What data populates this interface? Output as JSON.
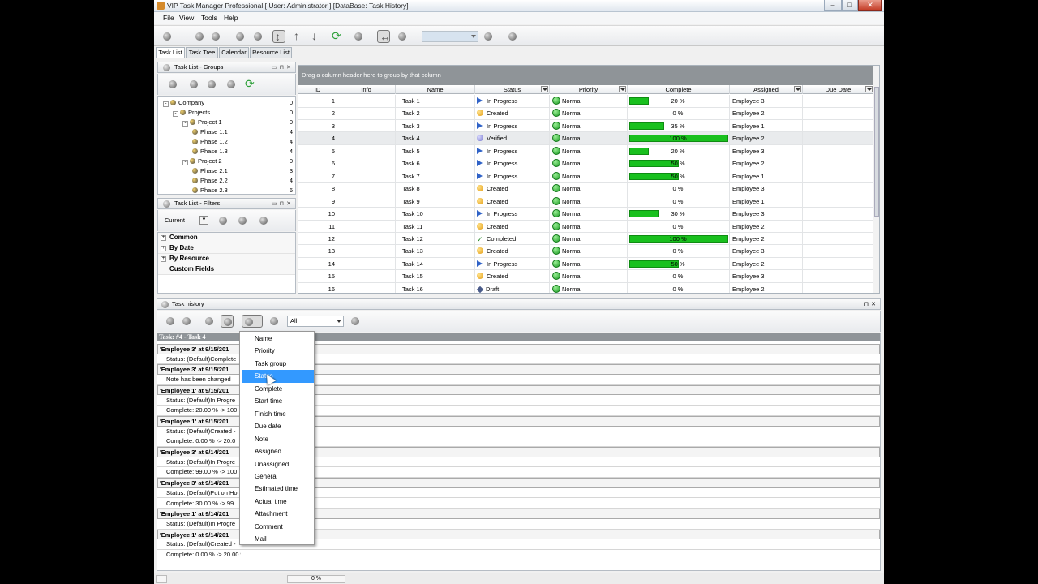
{
  "window": {
    "title": "VIP Task Manager Professional [ User: Administrator ] [DataBase: Task History]",
    "controls": {
      "minimize": "–",
      "maximize": "□",
      "close": "✕"
    }
  },
  "menu": [
    "File",
    "View",
    "Tools",
    "Help"
  ],
  "tabs": [
    "Task List",
    "Task Tree",
    "Calendar",
    "Resource List"
  ],
  "groups_panel": {
    "title": "Task List - Groups",
    "tree": [
      {
        "label": "Company",
        "count": "0",
        "level": 0,
        "toggle": "-"
      },
      {
        "label": "Projects",
        "count": "0",
        "level": 1,
        "toggle": "-"
      },
      {
        "label": "Project 1",
        "count": "0",
        "level": 2,
        "toggle": "-"
      },
      {
        "label": "Phase 1.1",
        "count": "4",
        "level": 3,
        "toggle": ""
      },
      {
        "label": "Phase 1.2",
        "count": "4",
        "level": 3,
        "toggle": ""
      },
      {
        "label": "Phase 1.3",
        "count": "4",
        "level": 3,
        "toggle": ""
      },
      {
        "label": "Project 2",
        "count": "0",
        "level": 2,
        "toggle": "-"
      },
      {
        "label": "Phase 2.1",
        "count": "3",
        "level": 3,
        "toggle": ""
      },
      {
        "label": "Phase 2.2",
        "count": "4",
        "level": 3,
        "toggle": ""
      },
      {
        "label": "Phase 2.3",
        "count": "6",
        "level": 3,
        "toggle": ""
      }
    ]
  },
  "filters_panel": {
    "title": "Task List - Filters",
    "current": "Current",
    "items": [
      {
        "label": "Common",
        "expandable": true
      },
      {
        "label": "By Date",
        "expandable": true
      },
      {
        "label": "By Resource",
        "expandable": true
      },
      {
        "label": "Custom Fields",
        "expandable": false
      }
    ]
  },
  "grid": {
    "group_hint": "Drag a column header here to group by that column",
    "columns": [
      "ID",
      "Info",
      "Name",
      "Status",
      "Priority",
      "Complete",
      "Assigned",
      "Due Date"
    ],
    "rows": [
      {
        "id": "1",
        "name": "Task 1",
        "status": "In Progress",
        "status_icon": "progress",
        "priority": "Normal",
        "complete": 20,
        "complete_label": "20 %",
        "assigned": "Employee 3"
      },
      {
        "id": "2",
        "name": "Task 2",
        "status": "Created",
        "status_icon": "created",
        "priority": "Normal",
        "complete": 0,
        "complete_label": "0 %",
        "assigned": "Employee 2"
      },
      {
        "id": "3",
        "name": "Task 3",
        "status": "In Progress",
        "status_icon": "progress",
        "priority": "Normal",
        "complete": 35,
        "complete_label": "35 %",
        "assigned": "Employee 1"
      },
      {
        "id": "4",
        "name": "Task 4",
        "status": "Verified",
        "status_icon": "verified",
        "priority": "Normal",
        "complete": 100,
        "complete_label": "100 %",
        "assigned": "Employee 2"
      },
      {
        "id": "5",
        "name": "Task 5",
        "status": "In Progress",
        "status_icon": "progress",
        "priority": "Normal",
        "complete": 20,
        "complete_label": "20 %",
        "assigned": "Employee 3"
      },
      {
        "id": "6",
        "name": "Task 6",
        "status": "In Progress",
        "status_icon": "progress",
        "priority": "Normal",
        "complete": 50,
        "complete_label": "50 %",
        "assigned": "Employee 2"
      },
      {
        "id": "7",
        "name": "Task 7",
        "status": "In Progress",
        "status_icon": "progress",
        "priority": "Normal",
        "complete": 50,
        "complete_label": "50 %",
        "assigned": "Employee 1"
      },
      {
        "id": "8",
        "name": "Task 8",
        "status": "Created",
        "status_icon": "created",
        "priority": "Normal",
        "complete": 0,
        "complete_label": "0 %",
        "assigned": "Employee 3"
      },
      {
        "id": "9",
        "name": "Task 9",
        "status": "Created",
        "status_icon": "created",
        "priority": "Normal",
        "complete": 0,
        "complete_label": "0 %",
        "assigned": "Employee 1"
      },
      {
        "id": "10",
        "name": "Task 10",
        "status": "In Progress",
        "status_icon": "progress",
        "priority": "Normal",
        "complete": 30,
        "complete_label": "30 %",
        "assigned": "Employee 3"
      },
      {
        "id": "11",
        "name": "Task 11",
        "status": "Created",
        "status_icon": "created",
        "priority": "Normal",
        "complete": 0,
        "complete_label": "0 %",
        "assigned": "Employee 2"
      },
      {
        "id": "12",
        "name": "Task 12",
        "status": "Completed",
        "status_icon": "completed",
        "priority": "Normal",
        "complete": 100,
        "complete_label": "100 %",
        "assigned": "Employee 2"
      },
      {
        "id": "13",
        "name": "Task 13",
        "status": "Created",
        "status_icon": "created",
        "priority": "Normal",
        "complete": 0,
        "complete_label": "0 %",
        "assigned": "Employee 3"
      },
      {
        "id": "14",
        "name": "Task 14",
        "status": "In Progress",
        "status_icon": "progress",
        "priority": "Normal",
        "complete": 50,
        "complete_label": "50 %",
        "assigned": "Employee 2"
      },
      {
        "id": "15",
        "name": "Task 15",
        "status": "Created",
        "status_icon": "created",
        "priority": "Normal",
        "complete": 0,
        "complete_label": "0 %",
        "assigned": "Employee 3"
      },
      {
        "id": "16",
        "name": "Task 16",
        "status": "Draft",
        "status_icon": "draft",
        "priority": "Normal",
        "complete": 0,
        "complete_label": "0 %",
        "assigned": "Employee 2"
      }
    ],
    "selected_row": 3
  },
  "history": {
    "title": "Task history",
    "filter_value": "All",
    "task_header": "Task: #4 - Task 4",
    "entries": [
      {
        "kind": "evt",
        "text": "'Employee 3' at 9/15/201"
      },
      {
        "kind": "det",
        "text": "Status: (Default)Complete"
      },
      {
        "kind": "evt",
        "text": "'Employee 3' at 9/15/201"
      },
      {
        "kind": "det",
        "text": "Note has been changed"
      },
      {
        "kind": "evt",
        "text": "'Employee 1' at 9/15/201"
      },
      {
        "kind": "det",
        "text": "Status: (Default)In Progre"
      },
      {
        "kind": "det",
        "text": "Complete: 20.00 % -> 100"
      },
      {
        "kind": "evt",
        "text": "'Employee 1' at 9/15/201"
      },
      {
        "kind": "det",
        "text": "Status: (Default)Created -"
      },
      {
        "kind": "det",
        "text": "Complete: 0.00 % -> 20.0"
      },
      {
        "kind": "evt",
        "text": "'Employee 3' at 9/14/201"
      },
      {
        "kind": "det",
        "text": "Status: (Default)In Progre"
      },
      {
        "kind": "det",
        "text": "Complete: 99.00 % -> 100"
      },
      {
        "kind": "evt",
        "text": "'Employee 3' at 9/14/201"
      },
      {
        "kind": "det",
        "text": "Status: (Default)Put on Ho"
      },
      {
        "kind": "det",
        "text": "Complete: 30.00 % -> 99."
      },
      {
        "kind": "evt",
        "text": "'Employee 1' at 9/14/201"
      },
      {
        "kind": "det",
        "text": "Status: (Default)In Progre"
      },
      {
        "kind": "evt",
        "text": "'Employee 1' at 9/14/201"
      },
      {
        "kind": "det",
        "text": "Status: (Default)Created -"
      },
      {
        "kind": "det",
        "text": "Complete: 0.00 % -> 20.00 %"
      }
    ]
  },
  "context_menu": {
    "items": [
      "Name",
      "Priority",
      "Task group",
      "Status",
      "Complete",
      "Start time",
      "Finish time",
      "Due date",
      "Note",
      "Assigned",
      "Unassigned",
      "General",
      "Estimated time",
      "Actual time",
      "Attachment",
      "Comment",
      "Mail"
    ],
    "highlighted": "Status"
  },
  "statusbar": {
    "progress": "0 %"
  },
  "colors": {
    "progress_bar": "#19c01e",
    "group_hint_bg": "#8f9498",
    "menu_highlight": "#3399ff"
  }
}
